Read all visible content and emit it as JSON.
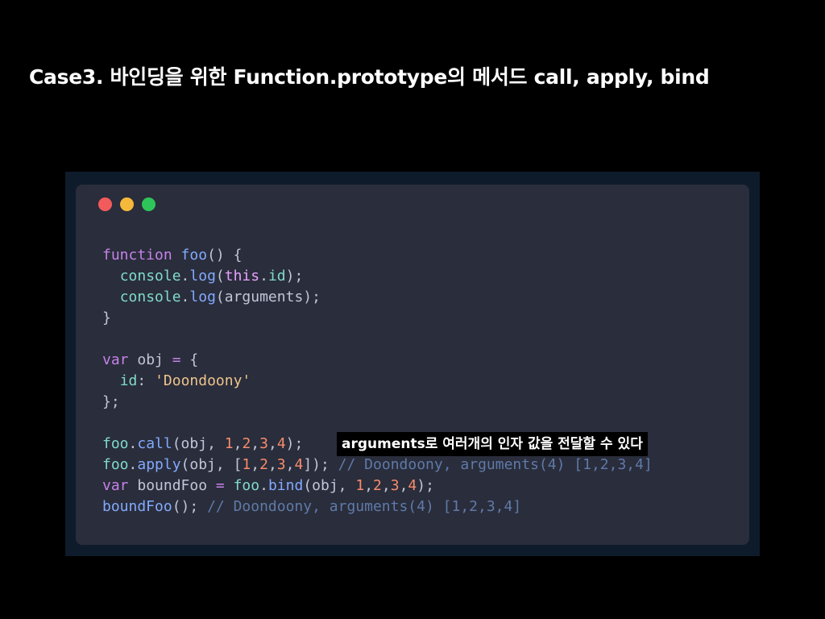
{
  "slide": {
    "title": "Case3. 바인딩을 위한 Function.prototype의 메서드 call, apply, bind"
  },
  "window": {
    "buttons": [
      {
        "name": "close",
        "color": "#f25b5b"
      },
      {
        "name": "minimize",
        "color": "#f5b83a"
      },
      {
        "name": "maximize",
        "color": "#2ec45a"
      }
    ]
  },
  "code": {
    "lines": [
      [
        {
          "t": "kw",
          "v": "function "
        },
        {
          "t": "fn",
          "v": "foo"
        },
        {
          "t": "plain",
          "v": "() {"
        }
      ],
      [
        {
          "t": "plain",
          "v": "  "
        },
        {
          "t": "prop",
          "v": "console"
        },
        {
          "t": "plain",
          "v": "."
        },
        {
          "t": "fn",
          "v": "log"
        },
        {
          "t": "plain",
          "v": "("
        },
        {
          "t": "this",
          "v": "this"
        },
        {
          "t": "plain",
          "v": "."
        },
        {
          "t": "prop",
          "v": "id"
        },
        {
          "t": "plain",
          "v": ");"
        }
      ],
      [
        {
          "t": "plain",
          "v": "  "
        },
        {
          "t": "prop",
          "v": "console"
        },
        {
          "t": "plain",
          "v": "."
        },
        {
          "t": "fn",
          "v": "log"
        },
        {
          "t": "plain",
          "v": "(arguments);"
        }
      ],
      [
        {
          "t": "plain",
          "v": "}"
        }
      ],
      [],
      [
        {
          "t": "kw",
          "v": "var "
        },
        {
          "t": "plain",
          "v": "obj "
        },
        {
          "t": "kw",
          "v": "= "
        },
        {
          "t": "plain",
          "v": "{"
        }
      ],
      [
        {
          "t": "plain",
          "v": "  "
        },
        {
          "t": "prop",
          "v": "id"
        },
        {
          "t": "plain",
          "v": ": "
        },
        {
          "t": "str",
          "v": "'Doondoony'"
        }
      ],
      [
        {
          "t": "plain",
          "v": "};"
        }
      ],
      [],
      [
        {
          "t": "prop",
          "v": "foo"
        },
        {
          "t": "plain",
          "v": "."
        },
        {
          "t": "fn",
          "v": "call"
        },
        {
          "t": "plain",
          "v": "(obj, "
        },
        {
          "t": "num",
          "v": "1"
        },
        {
          "t": "plain",
          "v": ","
        },
        {
          "t": "num",
          "v": "2"
        },
        {
          "t": "plain",
          "v": ","
        },
        {
          "t": "num",
          "v": "3"
        },
        {
          "t": "plain",
          "v": ","
        },
        {
          "t": "num",
          "v": "4"
        },
        {
          "t": "plain",
          "v": ");"
        }
      ],
      [
        {
          "t": "prop",
          "v": "foo"
        },
        {
          "t": "plain",
          "v": "."
        },
        {
          "t": "fn",
          "v": "apply"
        },
        {
          "t": "plain",
          "v": "(obj, ["
        },
        {
          "t": "num",
          "v": "1"
        },
        {
          "t": "plain",
          "v": ","
        },
        {
          "t": "num",
          "v": "2"
        },
        {
          "t": "plain",
          "v": ","
        },
        {
          "t": "num",
          "v": "3"
        },
        {
          "t": "plain",
          "v": ","
        },
        {
          "t": "num",
          "v": "4"
        },
        {
          "t": "plain",
          "v": "]); "
        },
        {
          "t": "cmt",
          "v": "// Doondoony, arguments(4) [1,2,3,4]"
        }
      ],
      [
        {
          "t": "kw",
          "v": "var "
        },
        {
          "t": "plain",
          "v": "boundFoo "
        },
        {
          "t": "kw",
          "v": "= "
        },
        {
          "t": "prop",
          "v": "foo"
        },
        {
          "t": "plain",
          "v": "."
        },
        {
          "t": "fn",
          "v": "bind"
        },
        {
          "t": "plain",
          "v": "(obj, "
        },
        {
          "t": "num",
          "v": "1"
        },
        {
          "t": "plain",
          "v": ","
        },
        {
          "t": "num",
          "v": "2"
        },
        {
          "t": "plain",
          "v": ","
        },
        {
          "t": "num",
          "v": "3"
        },
        {
          "t": "plain",
          "v": ","
        },
        {
          "t": "num",
          "v": "4"
        },
        {
          "t": "plain",
          "v": ");"
        }
      ],
      [
        {
          "t": "fn",
          "v": "boundFoo"
        },
        {
          "t": "plain",
          "v": "(); "
        },
        {
          "t": "cmt",
          "v": "// Doondoony, arguments(4) [1,2,3,4]"
        }
      ]
    ]
  },
  "annotation": {
    "text": "arguments로 여러개의 인자 값을 전달할 수 있다"
  }
}
